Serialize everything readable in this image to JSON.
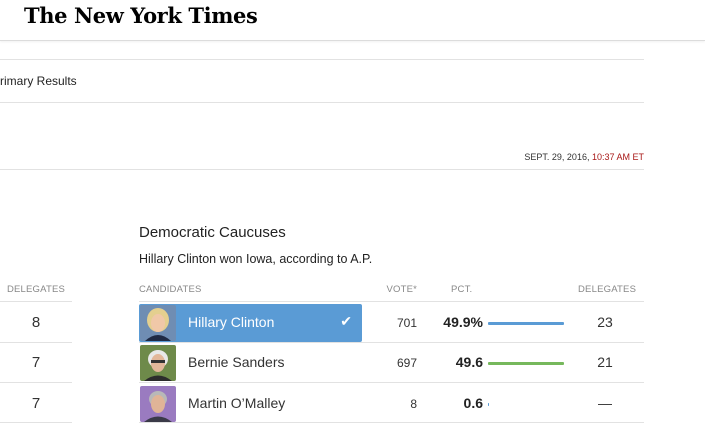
{
  "header": {
    "logo_text": "The New York Times"
  },
  "breadcrumb": "rimary Results",
  "timestamp": {
    "date": "SEPT. 29, 2016,",
    "time": "10:37 AM ET"
  },
  "left_table": {
    "header": "DELEGATES",
    "values": [
      "8",
      "7",
      "7"
    ]
  },
  "race": {
    "title": "Democratic Caucuses",
    "subtitle": "Hillary Clinton won Iowa, according to A.P.",
    "columns": {
      "candidates": "CANDIDATES",
      "votes": "VOTE*",
      "pct": "PCT.",
      "delegates": "DELEGATES"
    },
    "candidates": [
      {
        "name": "Hillary Clinton",
        "votes": "701",
        "pct": "49.9%",
        "pct_value": 49.9,
        "delegates": "23",
        "winner": true,
        "check": "✔",
        "bar_color": "#5a9bd5"
      },
      {
        "name": "Bernie Sanders",
        "votes": "697",
        "pct": "49.6",
        "pct_value": 49.6,
        "delegates": "21",
        "winner": false,
        "bar_color": "#76b85c"
      },
      {
        "name": "Martin O’Malley",
        "votes": "8",
        "pct": "0.6",
        "pct_value": 0.6,
        "delegates": "—",
        "winner": false,
        "bar_color": "#5a9bd5"
      }
    ]
  },
  "colors": {
    "winner_highlight": "#5a9bd5",
    "timestamp_time": "#a81817"
  }
}
